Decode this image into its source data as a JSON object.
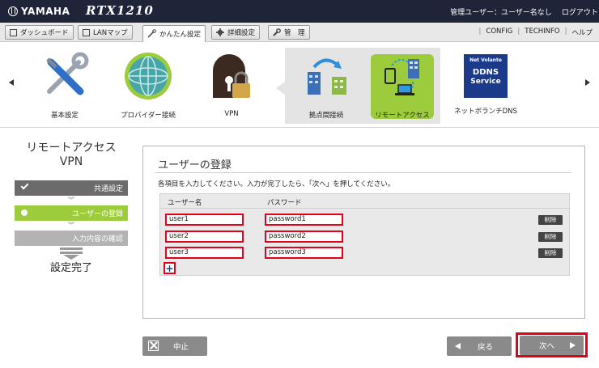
{
  "header": {
    "brand": "YAMAHA",
    "model": "RTX1210",
    "user_label": "管理ユーザー：ユーザー名なし",
    "logout": "ログアウト"
  },
  "tabs": [
    {
      "label": "ダッシュボード",
      "icon": "dashboard-icon"
    },
    {
      "label": "LANマップ",
      "icon": "lan-map-icon"
    },
    {
      "label": "かんたん設定",
      "icon": "wand-icon"
    },
    {
      "label": "詳細設定",
      "icon": "gear-icon"
    },
    {
      "label": "管　理",
      "icon": "wrench-icon"
    }
  ],
  "toplinks": [
    "CONFIG",
    "TECHINFO",
    "ヘルプ"
  ],
  "categories": [
    {
      "label": "基本設定",
      "icon": "tools-icon"
    },
    {
      "label": "プロバイダー接続",
      "icon": "globe-icon"
    },
    {
      "label": "VPN",
      "icon": "vpn-lock-icon"
    },
    {
      "label": "拠点間接続",
      "icon": "site-to-site-icon"
    },
    {
      "label": "リモートアクセス",
      "icon": "remote-access-icon"
    },
    {
      "label": "ネットボランチDNS",
      "icon": "ddns-icon"
    }
  ],
  "ddns_logo": {
    "top": "Net Volante",
    "line1": "DDNS",
    "line2": "Service"
  },
  "wizard": {
    "title_line1": "リモートアクセス",
    "title_line2": "VPN",
    "steps": [
      {
        "label": "共通設定",
        "state": "done"
      },
      {
        "label": "ユーザーの登録",
        "state": "current"
      },
      {
        "label": "入力内容の確認",
        "state": "todo"
      }
    ],
    "final": "設定完了"
  },
  "form": {
    "title": "ユーザーの登録",
    "instruction": "各項目を入力してください。入力が完了したら、「次へ」を押してください。",
    "col_user": "ユーザー名",
    "col_pass": "パスワード",
    "delete_label": "削除",
    "add_label": "+",
    "rows": [
      {
        "user": "user1",
        "pass": "password1"
      },
      {
        "user": "user2",
        "pass": "password2"
      },
      {
        "user": "user3",
        "pass": "password3"
      }
    ]
  },
  "buttons": {
    "cancel": "中止",
    "back": "戻る",
    "next": "次へ"
  },
  "colors": {
    "topbar": "#1f2438",
    "accent_green": "#9ccc3c",
    "highlight_red": "#e3001b",
    "button_gray": "#8a8a8a"
  }
}
